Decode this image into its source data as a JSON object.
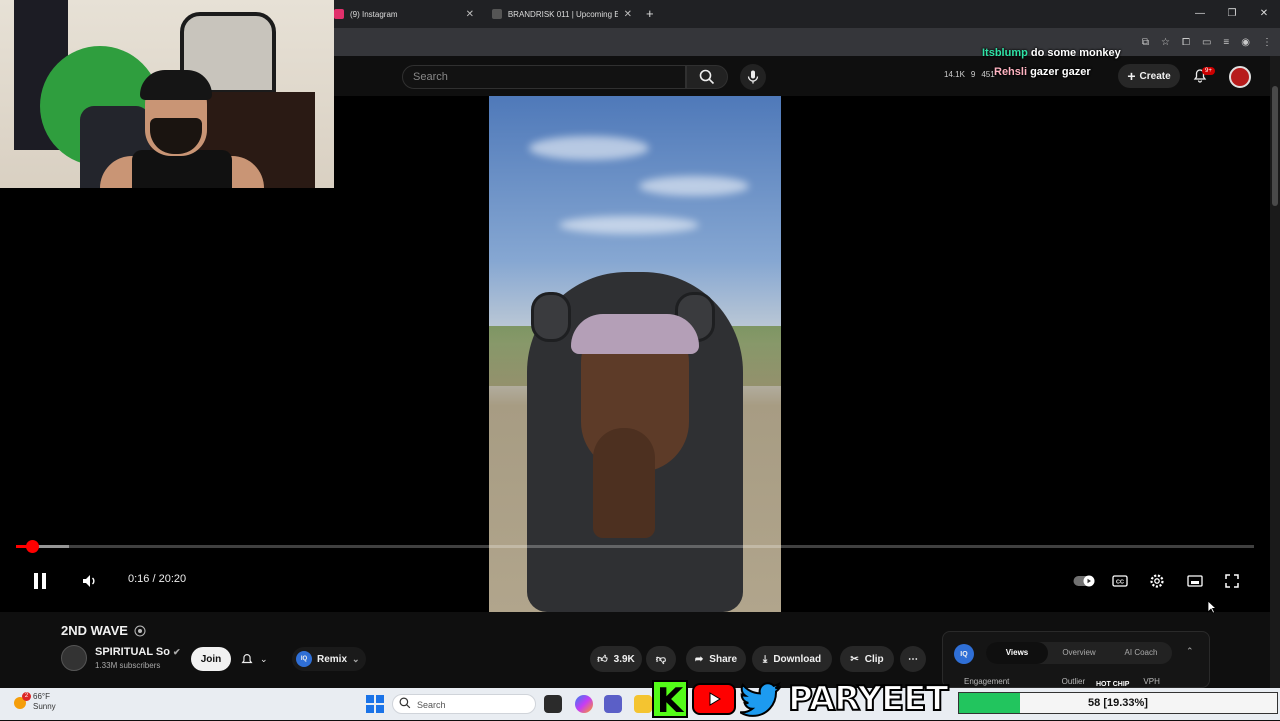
{
  "browser": {
    "tabs": [
      {
        "label": "(9) Instagram",
        "color": "#e1306c"
      },
      {
        "label": "BRANDRISK 011 | Upcoming E",
        "color": "#333333"
      }
    ]
  },
  "youtube": {
    "search_placeholder": "Search",
    "stats": {
      "views": "14.1K",
      "a": "9",
      "b": "451"
    },
    "create_label": "Create",
    "notifications_badge": "9+"
  },
  "chat": [
    {
      "user": "Itsblump",
      "user_color": "#2fe3a6",
      "message": "do some monkey"
    },
    {
      "user": "Rehsli",
      "user_color": "#ffb3c1",
      "message": "gazer gazer"
    }
  ],
  "player": {
    "time": "0:16 / 20:20",
    "progress_fraction": 0.013,
    "buffer_fraction": 0.043
  },
  "video": {
    "title": "2ND WAVE",
    "channel": "SPIRITUAL So",
    "subscribers": "1.33M subscribers",
    "join_label": "Join",
    "remix_label": "Remix",
    "likes": "3.9K",
    "share_label": "Share",
    "download_label": "Download",
    "clip_label": "Clip"
  },
  "iq_panel": {
    "logo": "IQ",
    "tabs": [
      "Views",
      "Overview",
      "AI Coach"
    ],
    "active_tab": "Views",
    "columns": [
      "Engagement",
      "Outlier",
      "VPH"
    ]
  },
  "taskbar": {
    "temp": "66°F",
    "condition": "Sunny",
    "weather_badge": "2",
    "search_placeholder": "Search"
  },
  "overlay": {
    "brand_name": "PARYEET",
    "k_letter": "K",
    "hot_chip": "HOT CHIP",
    "goal_text": "58 [19.33%]",
    "goal_fraction": 0.1933
  }
}
